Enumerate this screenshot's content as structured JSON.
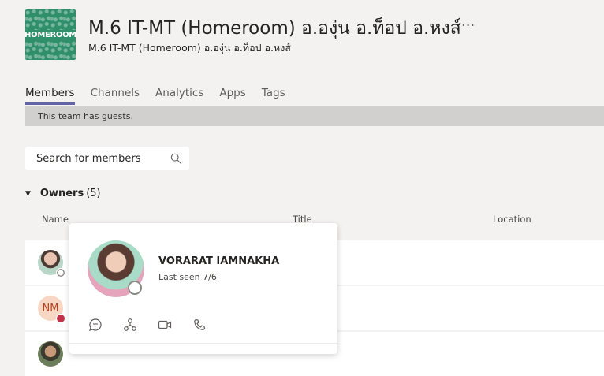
{
  "team": {
    "logo_text": "HOMEROOM",
    "title": "M.6 IT-MT (Homeroom) อ.องุ่น อ.ท็อป อ.หงส์",
    "more": "···",
    "subtitle": "M.6 IT-MT (Homeroom) อ.องุ่น อ.ท็อป อ.หงส์"
  },
  "tabs": [
    {
      "label": "Members",
      "active": true
    },
    {
      "label": "Channels"
    },
    {
      "label": "Analytics"
    },
    {
      "label": "Apps"
    },
    {
      "label": "Tags"
    }
  ],
  "guest_notice": "This team has guests.",
  "search": {
    "placeholder": "Search for members"
  },
  "owners": {
    "label": "Owners",
    "count": "(5)"
  },
  "columns": {
    "name": "Name",
    "title": "Title",
    "location": "Location"
  },
  "members": [
    {
      "status": "offline"
    },
    {
      "initials": "NM",
      "status": "busy"
    },
    {
      "status": "none"
    }
  ],
  "profile_card": {
    "name": "VORARAT IAMNAKHA",
    "last_seen": "Last seen 7/6",
    "actions": [
      "chat-icon",
      "org-chart-icon",
      "video-call-icon",
      "phone-icon"
    ]
  },
  "colors": {
    "accent": "#6264a7",
    "busy": "#c4314b",
    "logo_bg": "#2f8f6b"
  }
}
